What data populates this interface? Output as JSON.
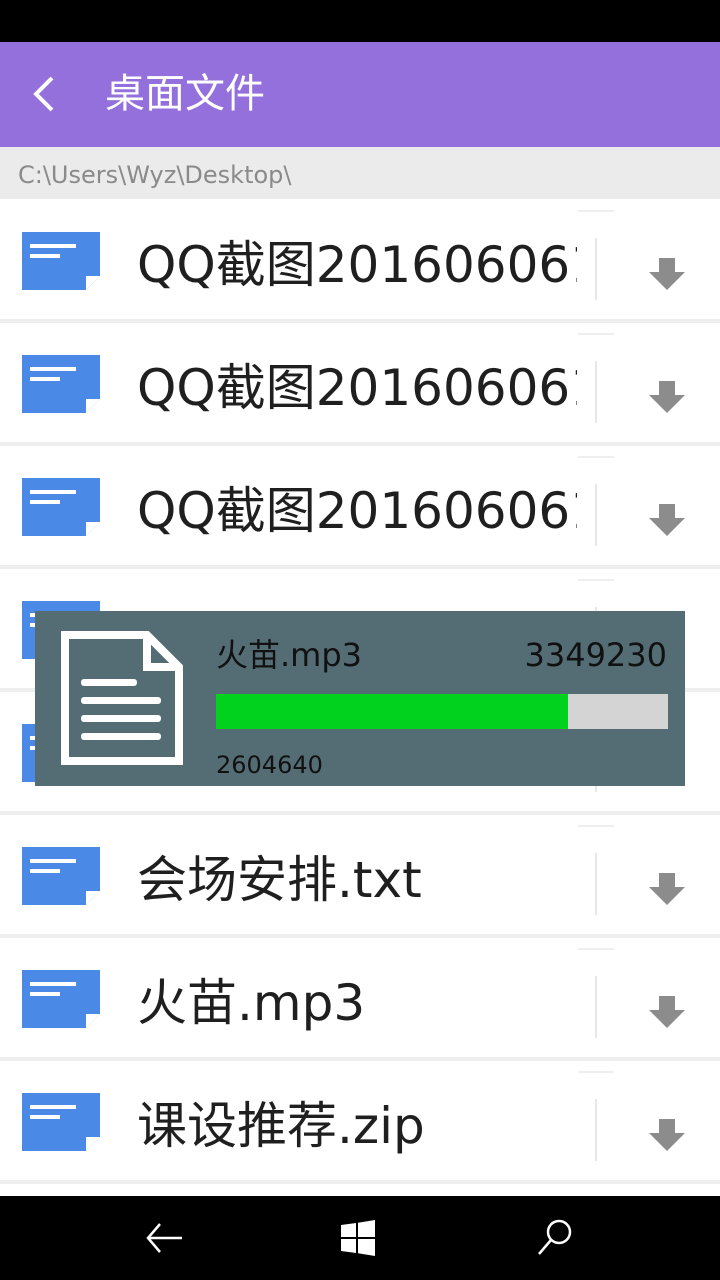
{
  "header": {
    "title": "桌面文件",
    "back_icon": "chevron-left-icon"
  },
  "path": "C:\\Users\\Wyz\\Desktop\\",
  "files": [
    {
      "name": "QQ截图201606061",
      "icon": "document-icon",
      "action_icon": "download-arrow-icon"
    },
    {
      "name": "QQ截图201606061",
      "icon": "document-icon",
      "action_icon": "download-arrow-icon"
    },
    {
      "name": "QQ截图201606061",
      "icon": "document-icon",
      "action_icon": "download-arrow-icon"
    },
    {
      "name": "",
      "icon": "document-icon",
      "action_icon": "download-arrow-icon"
    },
    {
      "name": "",
      "icon": "document-icon",
      "action_icon": "download-arrow-icon"
    },
    {
      "name": "会场安排.txt",
      "icon": "document-icon",
      "action_icon": "download-arrow-icon"
    },
    {
      "name": "火苗.mp3",
      "icon": "document-icon",
      "action_icon": "download-arrow-icon"
    },
    {
      "name": "课设推荐.zip",
      "icon": "document-icon",
      "action_icon": "download-arrow-icon"
    }
  ],
  "download": {
    "filename": "火苗.mp3",
    "total_bytes": "3349230",
    "downloaded_bytes": "2604640",
    "progress_fraction": 0.778,
    "icon": "document-page-icon"
  },
  "nav": {
    "back_icon": "back-arrow-icon",
    "home_icon": "windows-logo-icon",
    "search_icon": "search-icon"
  },
  "colors": {
    "header_bg": "#9370db",
    "path_bg": "#ebebeb",
    "popup_bg": "#546d75",
    "progress_fill": "#00d21e",
    "progress_track": "#d4d4d4",
    "file_icon": "#4a8ae6",
    "download_icon": "#8c8c8c"
  }
}
